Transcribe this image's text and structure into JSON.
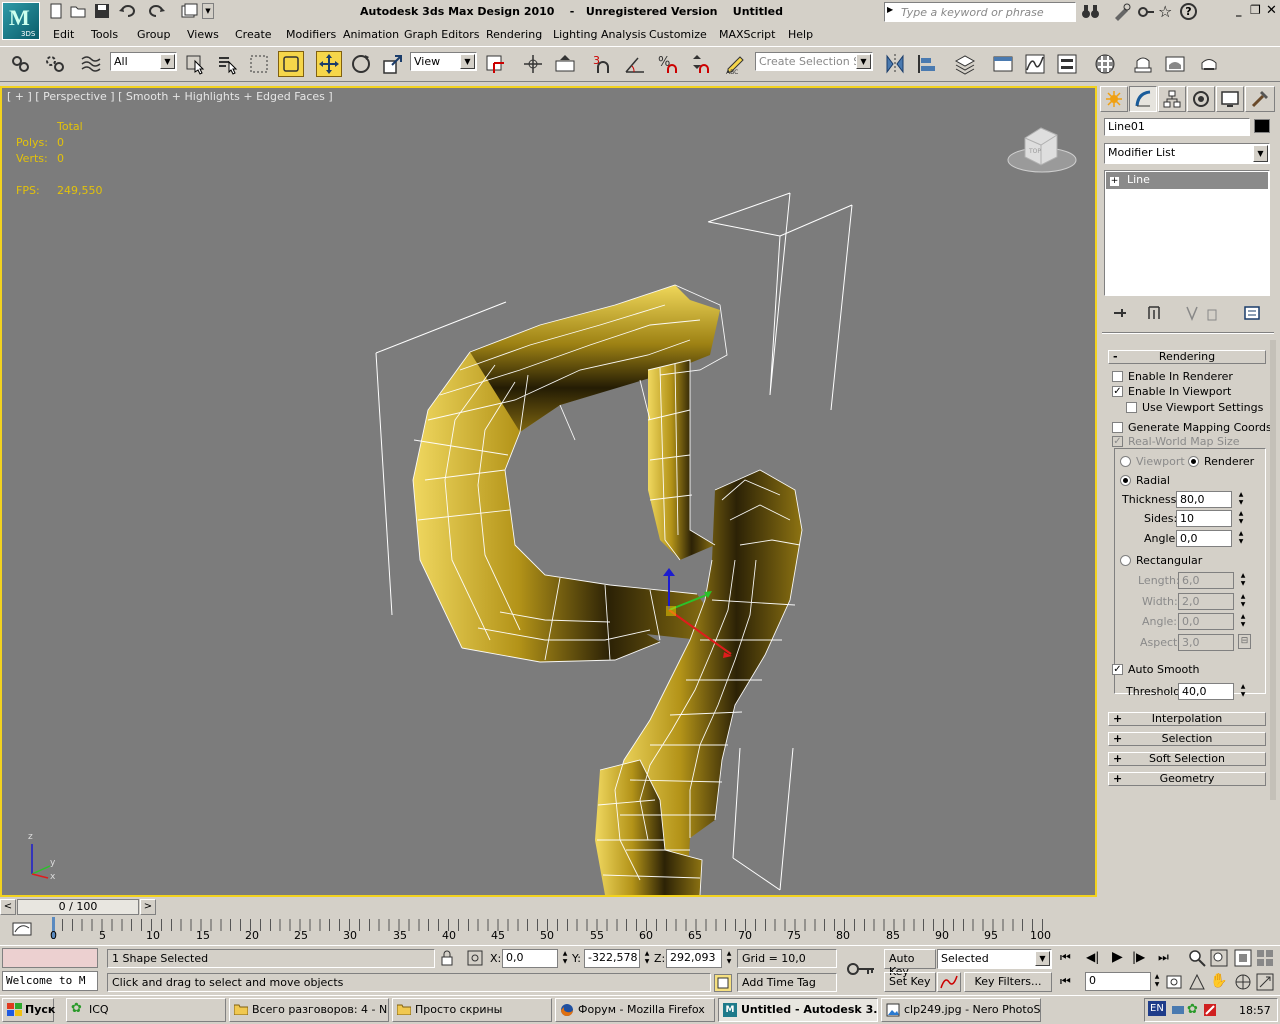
{
  "window": {
    "title": "Autodesk 3ds Max Design 2010    -   Unregistered Version    Untitled",
    "logo_sub": "3DS",
    "search_placeholder": "Type a keyword or phrase"
  },
  "menu": [
    "Edit",
    "Tools",
    "Group",
    "Views",
    "Create",
    "Modifiers",
    "Animation",
    "Graph Editors",
    "Rendering",
    "Lighting Analysis",
    "Customize",
    "MAXScript",
    "Help"
  ],
  "toolbar": {
    "filter_value": "All",
    "refcoord_value": "View",
    "selection_set_placeholder": "Create Selection Se"
  },
  "viewport": {
    "label": "[ + ] [ Perspective ] [ Smooth + Highlights + Edged Faces ]",
    "stats": {
      "total_label": "Total",
      "polys_label": "Polys:",
      "polys_value": "0",
      "verts_label": "Verts:",
      "verts_value": "0",
      "fps_label": "FPS:",
      "fps_value": "249,550"
    },
    "axis": {
      "z": "z",
      "y": "y",
      "x": "x"
    },
    "viewcube_face": "TOP"
  },
  "command_panel": {
    "object_name": "Line01",
    "modifier_list": "Modifier List",
    "stack": [
      {
        "label": "Line"
      }
    ],
    "rendering": {
      "title": "Rendering",
      "enable_in_renderer": "Enable In Renderer",
      "enable_in_renderer_checked": false,
      "enable_in_viewport": "Enable In Viewport",
      "enable_in_viewport_checked": true,
      "use_viewport_settings": "Use Viewport Settings",
      "generate_mapping": "Generate Mapping Coords.",
      "real_world_map": "Real-World Map Size",
      "viewport_radio": "Viewport",
      "renderer_radio": "Renderer",
      "radial": "Radial",
      "thickness_label": "Thickness:",
      "thickness_value": "80,0",
      "sides_label": "Sides:",
      "sides_value": "10",
      "angle_label": "Angle:",
      "angle_value": "0,0",
      "rectangular": "Rectangular",
      "length_label": "Length:",
      "length_value": "6,0",
      "width_label": "Width:",
      "width_value": "2,0",
      "rect_angle_label": "Angle:",
      "rect_angle_value": "0,0",
      "aspect_label": "Aspect:",
      "aspect_value": "3,0",
      "auto_smooth": "Auto Smooth",
      "threshold_label": "Threshold:",
      "threshold_value": "40,0"
    },
    "rollouts": [
      "Interpolation",
      "Selection",
      "Soft Selection",
      "Geometry"
    ]
  },
  "timeline": {
    "slider_label": "0 / 100",
    "ticks": [
      "0",
      "5",
      "10",
      "15",
      "20",
      "25",
      "30",
      "35",
      "40",
      "45",
      "50",
      "55",
      "60",
      "65",
      "70",
      "75",
      "80",
      "85",
      "90",
      "95",
      "100"
    ]
  },
  "status": {
    "maxscript_listener": "Welcome to M",
    "selection": "1 Shape Selected",
    "prompt": "Click and drag to select and move objects",
    "x_label": "X:",
    "x_value": "0,0",
    "y_label": "Y:",
    "y_value": "-322,578",
    "z_label": "Z:",
    "z_value": "292,093",
    "grid": "Grid = 10,0",
    "add_time_tag": "Add Time Tag",
    "auto_key": "Auto Key",
    "set_key": "Set Key",
    "key_mode": "Selected",
    "key_filters": "Key Filters...",
    "frame_value": "0"
  },
  "taskbar": {
    "start": "Пуск",
    "tasks": [
      {
        "label": "ICQ",
        "active": false
      },
      {
        "label": "Всего разговоров: 4 - N...",
        "active": false
      },
      {
        "label": "Просто скрины",
        "active": false
      },
      {
        "label": "Форум - Mozilla Firefox",
        "active": false
      },
      {
        "label": "Untitled - Autodesk 3...",
        "active": true
      },
      {
        "label": "clp249.jpg - Nero PhotoS...",
        "active": false
      }
    ],
    "lang": "EN",
    "clock": "18:57"
  },
  "colors": {
    "viewport_bg": "#7c7c7c",
    "viewport_border": "#f2d21e",
    "stats_text": "#e3c20a",
    "shape_fill": "#c4a524"
  }
}
